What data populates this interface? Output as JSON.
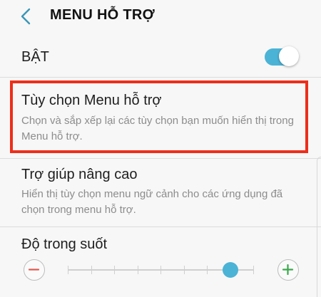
{
  "header": {
    "title": "MENU HỖ TRỢ",
    "back_icon": "chevron-left-icon"
  },
  "master_switch": {
    "label": "BẬT",
    "on": true
  },
  "items": [
    {
      "title": "Tùy chọn Menu hỗ trợ",
      "description": "Chọn và sắp xếp lại các tùy chọn bạn muốn hiển thị trong Menu hỗ trợ.",
      "highlighted": true
    },
    {
      "title": "Trợ giúp nâng cao",
      "description": "Hiển thị tùy chọn menu ngữ cảnh cho các ứng dụng đã chọn trong menu hỗ trợ."
    },
    {
      "title": "Độ trong suốt"
    }
  ],
  "transparency_slider": {
    "ticks": 9,
    "selected_step": 7,
    "minus_icon": "minus-icon",
    "plus_icon": "plus-icon"
  },
  "colors": {
    "accent": "#4bb3d6",
    "highlight_border": "#ee2e1a",
    "minus": "#e05a52",
    "plus": "#3aa84a"
  }
}
